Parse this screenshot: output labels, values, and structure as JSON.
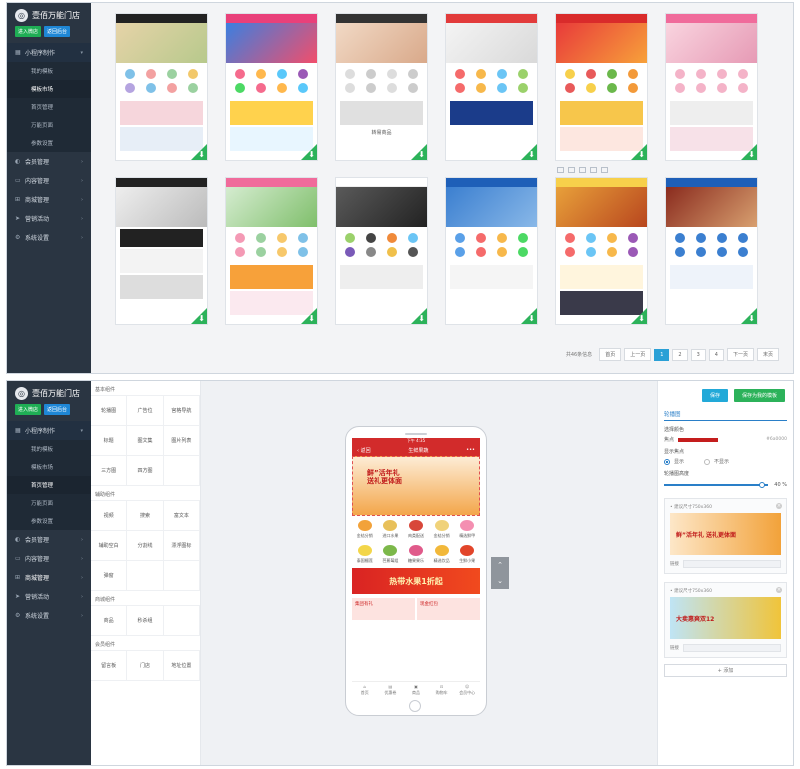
{
  "top": {
    "brand": {
      "name": "壹佰万能门店",
      "btn_view_store": "进入微店",
      "btn_return_admin": "返回后台"
    },
    "nav": [
      {
        "label": "小程序制作",
        "expanded": true,
        "subs": [
          "我的模板",
          "模板市场",
          "首页管理",
          "万能页面",
          "参数设置"
        ],
        "current_index": 1
      },
      {
        "label": "会员管理"
      },
      {
        "label": "内容管理"
      },
      {
        "label": "商城管理"
      },
      {
        "label": "营销活动"
      },
      {
        "label": "系统设置"
      }
    ],
    "template_card_label": "转易商品",
    "pager": {
      "total": "共46条信息",
      "first": "首页",
      "prev": "上一页",
      "pages": [
        "1",
        "2",
        "3",
        "4"
      ],
      "next": "下一页",
      "last": "末页"
    }
  },
  "bottom": {
    "brand": {
      "name": "壹佰万能门店",
      "btn_view_store": "进入微店",
      "btn_return_admin": "返回后台"
    },
    "nav": [
      {
        "label": "小程序制作",
        "expanded": true,
        "subs": [
          "我的模板",
          "模板市场",
          "首页管理",
          "万能页面",
          "参数设置"
        ],
        "current_index": 2
      },
      {
        "label": "会员管理"
      },
      {
        "label": "内容管理"
      },
      {
        "label": "商城管理"
      },
      {
        "label": "营销活动"
      },
      {
        "label": "系统设置"
      }
    ],
    "components": {
      "basic_title": "基本组件",
      "basic": [
        "轮播图",
        "广告位",
        "宫格导航",
        "标题",
        "图文集",
        "图片列表",
        "三方图",
        "四方图",
        ""
      ],
      "assist_title": "辅助组件",
      "assist": [
        "视频",
        "搜索",
        "富文本",
        "辅助空白",
        "分割线",
        "漂浮图标",
        "弹窗",
        "",
        ""
      ],
      "mall_title": "商城组件",
      "mall": [
        "商品",
        "秒杀组",
        ""
      ],
      "shop_title": "会员组件",
      "shop": [
        "留言板",
        "门店",
        "地址位置"
      ]
    },
    "phone": {
      "status": "下午 4:35",
      "back": "返回",
      "title": "生鲜果蔬",
      "more": "•••",
      "hero_line1": "鲜”活年礼",
      "hero_line2": "送礼更体面",
      "categories": [
        "金桔分销",
        "进口水果",
        "肉类配送",
        "金桔分销",
        "精选鲜甲",
        "泰国榴莲",
        "芭蕉莓组",
        "糖果果乐",
        "精选饮品",
        "生鲜小果"
      ],
      "promo": "热带水果1折起",
      "half_left": "集团有礼",
      "half_right": "现金红包",
      "tabbar": [
        "首页",
        "优惠卷",
        "商品",
        "购物车",
        "会员中心"
      ]
    },
    "props": {
      "btn_save": "保存",
      "btn_save_template": "保存为我的模板",
      "section": "轮播图",
      "select_color_label": "选择颜色",
      "color_name": "焦点",
      "color_hex": "#6a0000",
      "show_dots_label": "显示焦点",
      "show_label": "显示",
      "hide_label": "不显示",
      "height_label": "轮播图高度",
      "height_value": "40 %",
      "slides": [
        {
          "hint": "• 建议尺寸750x360",
          "img_text": "鲜”活年礼 送礼更体面",
          "link_label": "链接"
        },
        {
          "hint": "• 建议尺寸750x360",
          "img_text": "大卖惠爽双12",
          "link_label": "链接"
        }
      ],
      "add_label": "+ 添加"
    }
  }
}
